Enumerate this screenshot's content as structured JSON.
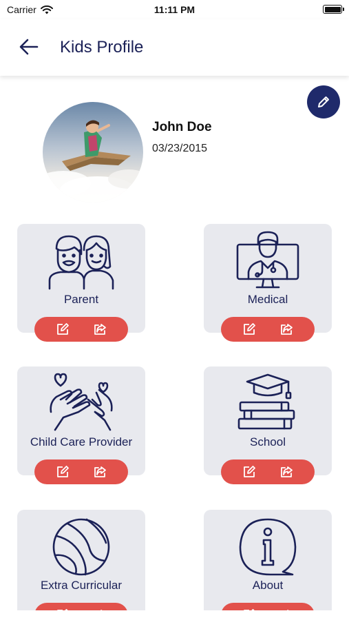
{
  "status_bar": {
    "carrier": "Carrier",
    "time": "11:11 PM"
  },
  "header": {
    "title": "Kids Profile"
  },
  "profile": {
    "name": "John Doe",
    "dob": "03/23/2015"
  },
  "cards": [
    {
      "label": "Parent",
      "icon": "parents-icon"
    },
    {
      "label": "Medical",
      "icon": "doctor-monitor-icon"
    },
    {
      "label": "Child Care Provider",
      "icon": "caring-hands-icon"
    },
    {
      "label": "School",
      "icon": "graduation-books-icon"
    },
    {
      "label": "Extra Curricular",
      "icon": "ball-icon"
    },
    {
      "label": "About",
      "icon": "info-icon"
    }
  ],
  "colors": {
    "primary": "#1b2157",
    "fab": "#1f2a6b",
    "action": "#e2514b",
    "card_bg": "#e8e9ee"
  }
}
